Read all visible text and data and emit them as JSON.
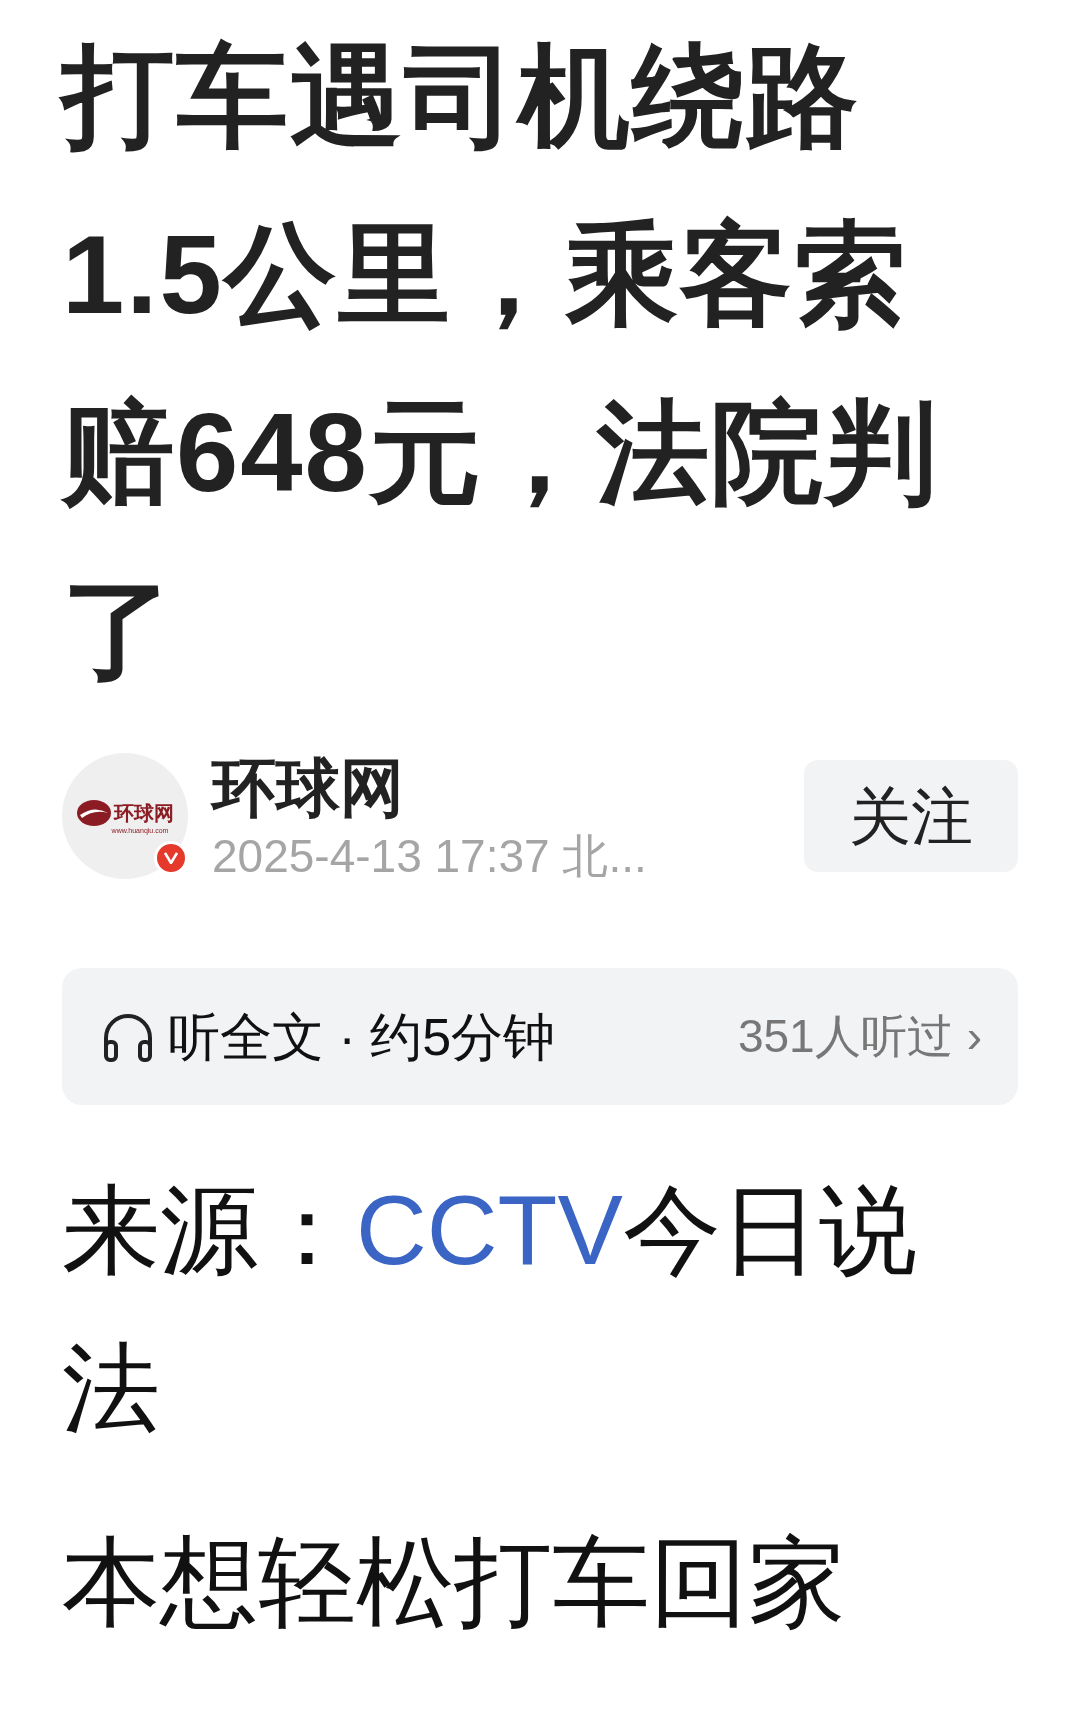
{
  "title": "打车遇司机绕路1.5公里，乘客索赔648元，法院判了",
  "author": {
    "logo_text": "环球网",
    "logo_url": "www.huanqiu.com",
    "verified": true,
    "name": "环球网",
    "meta": "2025-4-13 17:37 北...",
    "follow": {
      "label": "关注",
      "followed": false
    }
  },
  "listen": {
    "label": "听全文 · 约5分钟",
    "listeners": "351人听过",
    "chevron": "›"
  },
  "source": {
    "label": "来源：",
    "link": "CCTV",
    "rest": "今日说法"
  },
  "paragraphs": [
    "本想轻松打车回家"
  ]
}
